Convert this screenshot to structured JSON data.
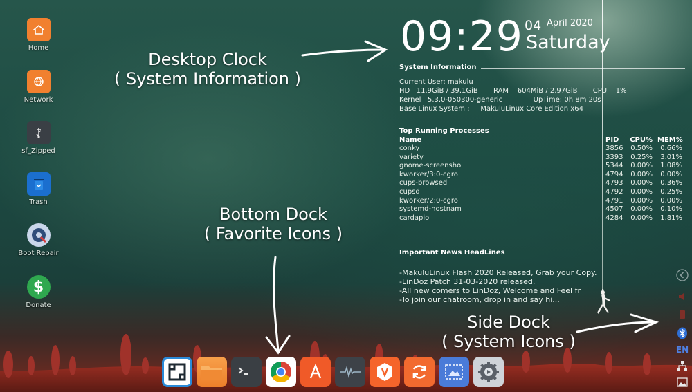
{
  "desktop_icons": [
    {
      "label": "Home",
      "icon": "home-folder-icon",
      "color": "#f1802f"
    },
    {
      "label": "Network",
      "icon": "network-folder-icon",
      "color": "#f1802f"
    },
    {
      "label": "sf_Zipped",
      "icon": "usb-drive-icon",
      "color": "#d8d8d8"
    },
    {
      "label": "Trash",
      "icon": "trash-icon",
      "color": "#1b6fcf"
    },
    {
      "label": "Boot Repair",
      "icon": "boot-repair-icon",
      "color": "#c9d6ea"
    },
    {
      "label": "Donate",
      "icon": "dollar-icon",
      "color": "#2fa84f"
    }
  ],
  "clock": {
    "time": "09:29",
    "day": "04",
    "month_year": "April 2020",
    "weekday": "Saturday"
  },
  "system_info": {
    "heading": "System Information",
    "lines": [
      "Current User: makulu",
      "HD   11.9GiB / 39.1GiB       RAM    604MiB / 2.97GiB       CPU    1%",
      "Kernel   5.3.0-050300-generic              UpTime: 0h 8m 20s",
      "Base Linux System :     MakuluLinux Core Edition x64"
    ]
  },
  "processes": {
    "heading": "Top Running Processes",
    "columns": [
      "Name",
      "PID",
      "CPU%",
      "MEM%"
    ],
    "rows": [
      [
        "conky",
        "3856",
        "0.50%",
        "0.66%"
      ],
      [
        "variety",
        "3393",
        "0.25%",
        "3.01%"
      ],
      [
        "gnome-screensho",
        "5344",
        "0.00%",
        "1.08%"
      ],
      [
        "kworker/3:0-cgro",
        "4794",
        "0.00%",
        "0.00%"
      ],
      [
        "cups-browsed",
        "4793",
        "0.00%",
        "0.36%"
      ],
      [
        "cupsd",
        "4792",
        "0.00%",
        "0.25%"
      ],
      [
        "kworker/2:0-cgro",
        "4791",
        "0.00%",
        "0.00%"
      ],
      [
        "systemd-hostnam",
        "4507",
        "0.00%",
        "0.10%"
      ],
      [
        "cardapio",
        "4284",
        "0.00%",
        "1.81%"
      ]
    ]
  },
  "news": {
    "heading": "Important News HeadLines",
    "lines": [
      "-MakuluLinux Flash 2020 Released, Grab your Copy.",
      "-LinDoz Patch 31-03-2020 released.",
      "-All new comers to LinDoz, Welcome and Feel fr",
      "-To join our chatroom, drop in and say hi..."
    ]
  },
  "annotations": {
    "clock_line1": "Desktop Clock",
    "clock_line2": "( System Information )",
    "dock_line1": "Bottom Dock",
    "dock_line2": "( Favorite Icons )",
    "side_line1": "Side Dock",
    "side_line2": "( System Icons )"
  },
  "dock_items": [
    {
      "icon": "window-manager-icon",
      "color": "#2a8ad8"
    },
    {
      "icon": "file-manager-folder-icon",
      "color": "#f1802f"
    },
    {
      "icon": "terminal-icon",
      "color": "#3a3f44"
    },
    {
      "icon": "chrome-browser-icon",
      "color": "#ffffff"
    },
    {
      "icon": "app-store-icon",
      "color": "#f05a28"
    },
    {
      "icon": "system-monitor-icon",
      "color": "#3d4248"
    },
    {
      "icon": "software-center-icon",
      "color": "#f5642b"
    },
    {
      "icon": "update-manager-icon",
      "color": "#f26a2f"
    },
    {
      "icon": "screenshot-tool-icon",
      "color": "#4a7bd8"
    },
    {
      "icon": "settings-gear-icon",
      "color": "#cfd3d8"
    }
  ],
  "side_dock": {
    "keyboard_layout": "EN"
  }
}
